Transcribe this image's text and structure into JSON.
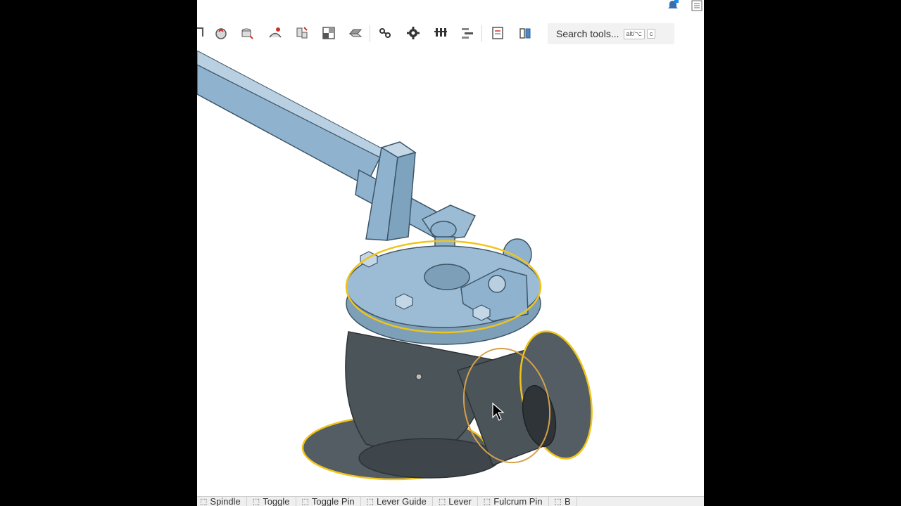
{
  "toolbar": {
    "search_placeholder": "Search tools...",
    "search_shortcut": "alt/⌥",
    "search_key": "c",
    "icons": [
      "sketch-icon",
      "extrude-icon",
      "revolve-icon",
      "sweep-icon",
      "loft-icon",
      "shell-icon",
      "fillet-icon",
      "mate-connector-icon",
      "gear-settings-icon",
      "pattern-icon",
      "align-icon",
      "drawing-icon",
      "part-studio-icon"
    ]
  },
  "bottom_tabs": [
    {
      "label": "Spindle"
    },
    {
      "label": "Toggle"
    },
    {
      "label": "Toggle Pin"
    },
    {
      "label": "Lever Guide"
    },
    {
      "label": "Lever"
    },
    {
      "label": "Fulcrum Pin"
    },
    {
      "label": "B"
    }
  ],
  "colors": {
    "part_blue": "#8fb3cf",
    "part_dark": "#4b5459",
    "selection": "#f0c419",
    "hover": "#d6a04a"
  }
}
